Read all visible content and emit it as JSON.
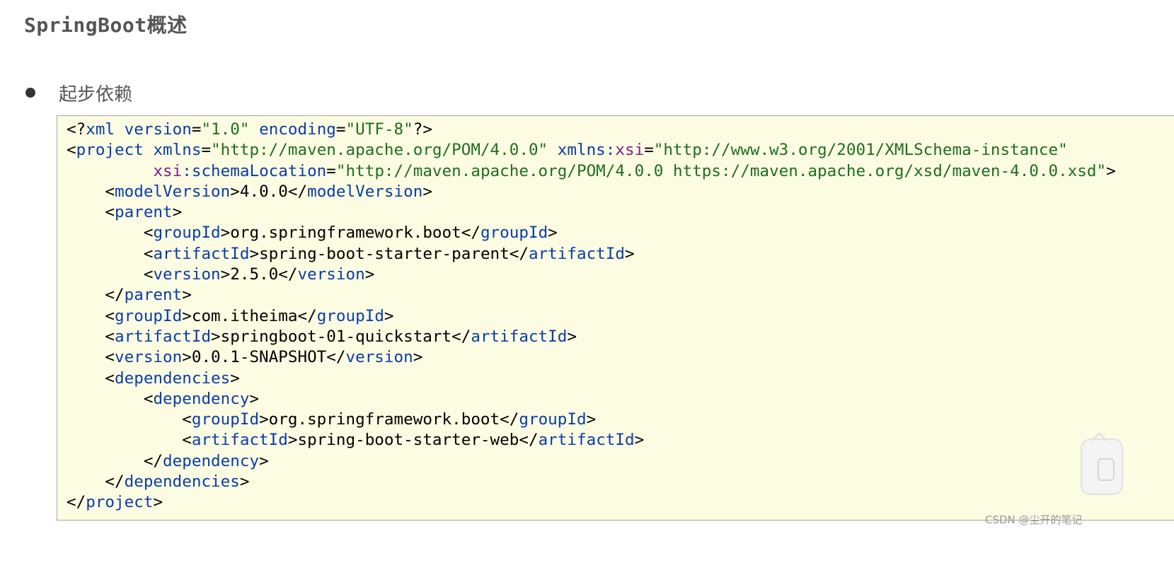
{
  "title": "SpringBoot概述",
  "bullet": {
    "label": "起步依赖"
  },
  "code": {
    "lines": [
      [
        {
          "t": "<?",
          "c": "br"
        },
        {
          "t": "xml",
          "c": "tag"
        },
        {
          "t": " ",
          "c": "text"
        },
        {
          "t": "version",
          "c": "attr"
        },
        {
          "t": "=",
          "c": "text"
        },
        {
          "t": "\"1.0\"",
          "c": "val"
        },
        {
          "t": " ",
          "c": "text"
        },
        {
          "t": "encoding",
          "c": "attr"
        },
        {
          "t": "=",
          "c": "text"
        },
        {
          "t": "\"UTF-8\"",
          "c": "val"
        },
        {
          "t": "?>",
          "c": "br"
        }
      ],
      [
        {
          "t": "<",
          "c": "br"
        },
        {
          "t": "project",
          "c": "tag"
        },
        {
          "t": " ",
          "c": "text"
        },
        {
          "t": "xmlns",
          "c": "attr"
        },
        {
          "t": "=",
          "c": "text"
        },
        {
          "t": "\"http://maven.apache.org/POM/4.0.0\"",
          "c": "val"
        },
        {
          "t": " ",
          "c": "text"
        },
        {
          "t": "xmlns:",
          "c": "attr"
        },
        {
          "t": "xsi",
          "c": "ns"
        },
        {
          "t": "=",
          "c": "text"
        },
        {
          "t": "\"http://www.w3.org/2001/XMLSchema-instance\"",
          "c": "val"
        }
      ],
      [
        {
          "t": "         ",
          "c": "text"
        },
        {
          "t": "xsi",
          "c": "ns"
        },
        {
          "t": ":schemaLocation",
          "c": "attr"
        },
        {
          "t": "=",
          "c": "text"
        },
        {
          "t": "\"http://maven.apache.org/POM/4.0.0 https://maven.apache.org/xsd/maven-4.0.0.xsd\"",
          "c": "val"
        },
        {
          "t": ">",
          "c": "br"
        }
      ],
      [
        {
          "t": "    <",
          "c": "br"
        },
        {
          "t": "modelVersion",
          "c": "tag"
        },
        {
          "t": ">",
          "c": "br"
        },
        {
          "t": "4.0.0",
          "c": "text"
        },
        {
          "t": "</",
          "c": "br"
        },
        {
          "t": "modelVersion",
          "c": "tag"
        },
        {
          "t": ">",
          "c": "br"
        }
      ],
      [
        {
          "t": "    <",
          "c": "br"
        },
        {
          "t": "parent",
          "c": "tag"
        },
        {
          "t": ">",
          "c": "br"
        }
      ],
      [
        {
          "t": "        <",
          "c": "br"
        },
        {
          "t": "groupId",
          "c": "tag"
        },
        {
          "t": ">",
          "c": "br"
        },
        {
          "t": "org.springframework.boot",
          "c": "text"
        },
        {
          "t": "</",
          "c": "br"
        },
        {
          "t": "groupId",
          "c": "tag"
        },
        {
          "t": ">",
          "c": "br"
        }
      ],
      [
        {
          "t": "        <",
          "c": "br"
        },
        {
          "t": "artifactId",
          "c": "tag"
        },
        {
          "t": ">",
          "c": "br"
        },
        {
          "t": "spring-boot-starter-parent",
          "c": "text"
        },
        {
          "t": "</",
          "c": "br"
        },
        {
          "t": "artifactId",
          "c": "tag"
        },
        {
          "t": ">",
          "c": "br"
        }
      ],
      [
        {
          "t": "        <",
          "c": "br"
        },
        {
          "t": "version",
          "c": "tag"
        },
        {
          "t": ">",
          "c": "br"
        },
        {
          "t": "2.5.0",
          "c": "text"
        },
        {
          "t": "</",
          "c": "br"
        },
        {
          "t": "version",
          "c": "tag"
        },
        {
          "t": ">",
          "c": "br"
        }
      ],
      [
        {
          "t": "    </",
          "c": "br"
        },
        {
          "t": "parent",
          "c": "tag"
        },
        {
          "t": ">",
          "c": "br"
        }
      ],
      [
        {
          "t": "    <",
          "c": "br"
        },
        {
          "t": "groupId",
          "c": "tag"
        },
        {
          "t": ">",
          "c": "br"
        },
        {
          "t": "com.itheima",
          "c": "text"
        },
        {
          "t": "</",
          "c": "br"
        },
        {
          "t": "groupId",
          "c": "tag"
        },
        {
          "t": ">",
          "c": "br"
        }
      ],
      [
        {
          "t": "    <",
          "c": "br"
        },
        {
          "t": "artifactId",
          "c": "tag"
        },
        {
          "t": ">",
          "c": "br"
        },
        {
          "t": "springboot-01-quickstart",
          "c": "text"
        },
        {
          "t": "</",
          "c": "br"
        },
        {
          "t": "artifactId",
          "c": "tag"
        },
        {
          "t": ">",
          "c": "br"
        }
      ],
      [
        {
          "t": "    <",
          "c": "br"
        },
        {
          "t": "version",
          "c": "tag"
        },
        {
          "t": ">",
          "c": "br"
        },
        {
          "t": "0.0.1-SNAPSHOT",
          "c": "text"
        },
        {
          "t": "</",
          "c": "br"
        },
        {
          "t": "version",
          "c": "tag"
        },
        {
          "t": ">",
          "c": "br"
        }
      ],
      [
        {
          "t": "    <",
          "c": "br"
        },
        {
          "t": "dependencies",
          "c": "tag"
        },
        {
          "t": ">",
          "c": "br"
        }
      ],
      [
        {
          "t": "        <",
          "c": "br"
        },
        {
          "t": "dependency",
          "c": "tag"
        },
        {
          "t": ">",
          "c": "br"
        }
      ],
      [
        {
          "t": "            <",
          "c": "br"
        },
        {
          "t": "groupId",
          "c": "tag"
        },
        {
          "t": ">",
          "c": "br"
        },
        {
          "t": "org.springframework.boot",
          "c": "text"
        },
        {
          "t": "</",
          "c": "br"
        },
        {
          "t": "groupId",
          "c": "tag"
        },
        {
          "t": ">",
          "c": "br"
        }
      ],
      [
        {
          "t": "            <",
          "c": "br"
        },
        {
          "t": "artifactId",
          "c": "tag"
        },
        {
          "t": ">",
          "c": "br"
        },
        {
          "t": "spring-boot-starter-web",
          "c": "text"
        },
        {
          "t": "</",
          "c": "br"
        },
        {
          "t": "artifactId",
          "c": "tag"
        },
        {
          "t": ">",
          "c": "br"
        }
      ],
      [
        {
          "t": "        </",
          "c": "br"
        },
        {
          "t": "dependency",
          "c": "tag"
        },
        {
          "t": ">",
          "c": "br"
        }
      ],
      [
        {
          "t": "    </",
          "c": "br"
        },
        {
          "t": "dependencies",
          "c": "tag"
        },
        {
          "t": ">",
          "c": "br"
        }
      ],
      [
        {
          "t": "</",
          "c": "br"
        },
        {
          "t": "project",
          "c": "tag"
        },
        {
          "t": ">",
          "c": "br"
        }
      ]
    ]
  },
  "watermark": "CSDN @尘开的笔记",
  "side_widget": {
    "icon": "clipboard-icon"
  }
}
